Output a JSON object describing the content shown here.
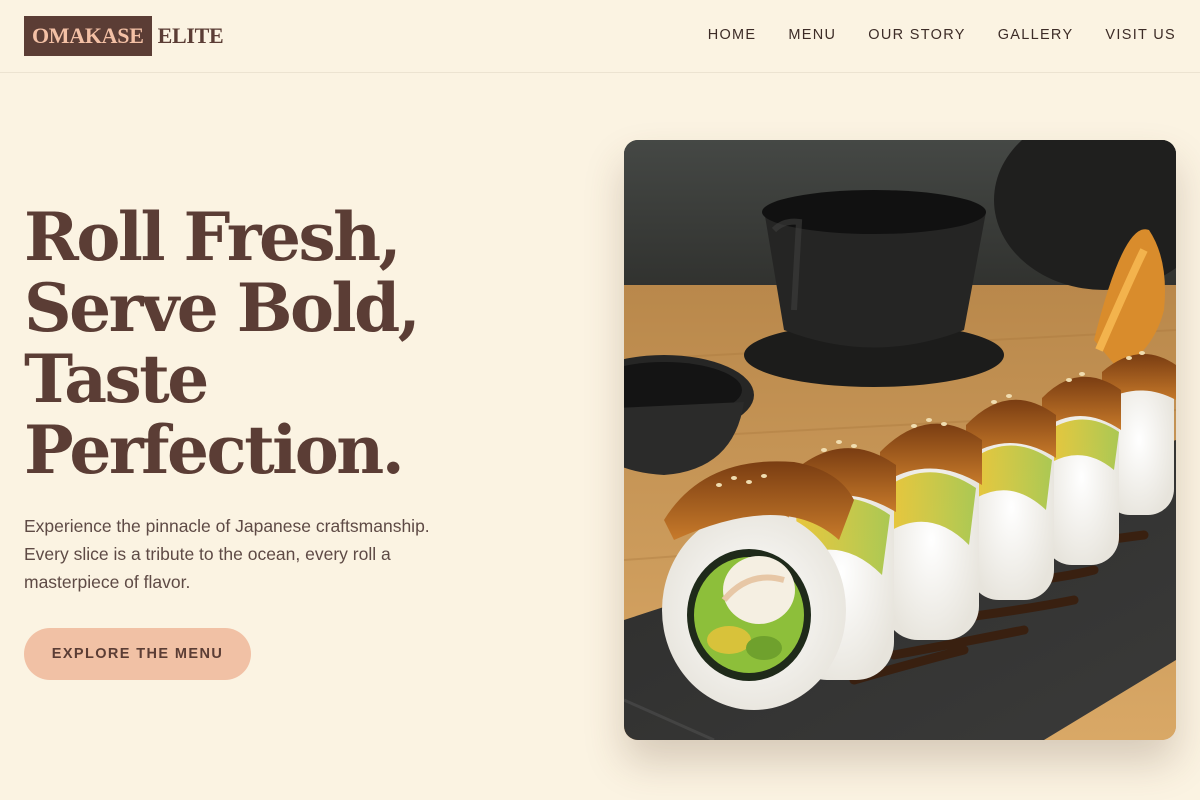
{
  "brand": {
    "logo_primary": "OMAKASE",
    "logo_secondary": "ELITE",
    "colors": {
      "background": "#fbf3e2",
      "brand_dark": "#5b3d35",
      "accent_peach": "#f1c1a5"
    }
  },
  "nav": {
    "items": [
      "HOME",
      "MENU",
      "OUR STORY",
      "GALLERY",
      "VISIT US"
    ]
  },
  "hero": {
    "title_lines": [
      "Roll Fresh,",
      "Serve Bold,",
      "Taste",
      "Perfection."
    ],
    "subtitle_lines": [
      "Experience the pinnacle of Japanese craftsmanship.",
      "Every slice is a tribute to the ocean, every roll a",
      "masterpiece of flavor."
    ],
    "cta_label": "EXPLORE THE MENU",
    "image": "sushi-roll-photo"
  }
}
